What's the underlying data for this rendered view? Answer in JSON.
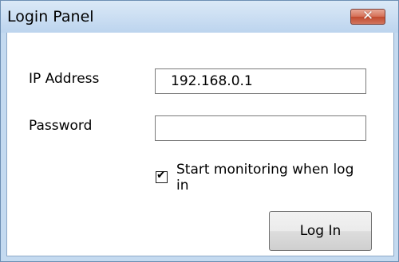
{
  "window": {
    "title": "Login Panel",
    "close_glyph": "✕",
    "close_icon": "close-icon"
  },
  "form": {
    "ip_label": "IP Address",
    "ip_value": "192.168.0.1",
    "password_label": "Password",
    "password_value": "",
    "monitor_checked": true,
    "monitor_check_glyph": "✔",
    "monitor_label": "Start monitoring when log in",
    "login_button": "Log In"
  },
  "colors": {
    "close_button": "#d46f56",
    "titlebar": "#c4daf0"
  }
}
